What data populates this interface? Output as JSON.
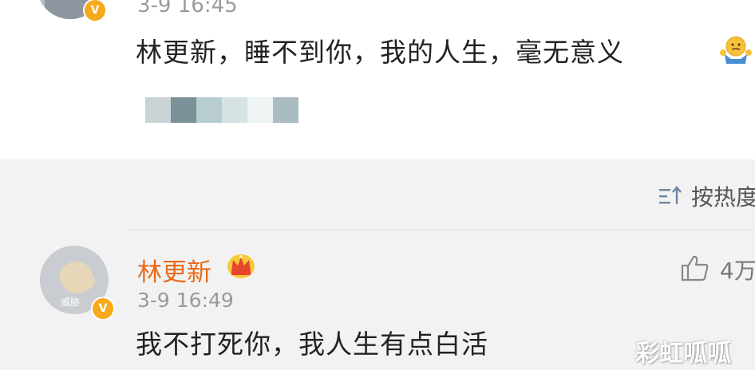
{
  "first_comment": {
    "time": "3-9 16:45",
    "badge": "V",
    "text": "林更新，睡不到你，我的人生，毫无意义",
    "emoji": "shrug-emoji",
    "blur_colors": [
      "#c9d3d6",
      "#7c9098",
      "#b7cdd0",
      "#d6e2e4",
      "#eef3f3",
      "#a9bcc2"
    ]
  },
  "sort": {
    "label": "按热度",
    "icon": "sort-icon"
  },
  "reply": {
    "username": "林更新",
    "time": "3-9 16:49",
    "badge": "V",
    "avatar_watermark": "威胁",
    "like_count": "4万",
    "text": "我不打死你，我人生有点白活"
  },
  "watermark": "彩虹呱呱",
  "colors": {
    "username": "#e86a1a",
    "badge": "#f7a91b",
    "background": "#f2f2f2"
  }
}
